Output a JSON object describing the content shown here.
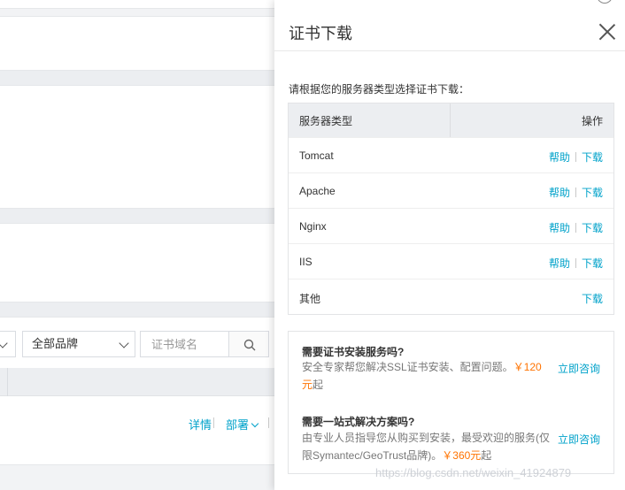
{
  "background": {
    "filter": {
      "brand_select": "全部品牌",
      "domain_placeholder": "证书域名"
    },
    "row_actions": {
      "detail": "详情",
      "deploy": "部署"
    }
  },
  "drawer": {
    "title": "证书下载",
    "instruction": "请根据您的服务器类型选择证书下载：",
    "table": {
      "headers": {
        "type": "服务器类型",
        "op": "操作"
      },
      "rows": [
        {
          "name": "Tomcat",
          "help": "帮助",
          "download": "下载"
        },
        {
          "name": "Apache",
          "help": "帮助",
          "download": "下载"
        },
        {
          "name": "Nginx",
          "help": "帮助",
          "download": "下载"
        },
        {
          "name": "IIS",
          "help": "帮助",
          "download": "下载"
        },
        {
          "name": "其他",
          "download": "下载"
        }
      ]
    },
    "services": [
      {
        "title": "需要证书安装服务吗?",
        "desc_prefix": "安全专家帮您解决SSL证书安装、配置问题。",
        "price": "￥120元",
        "desc_suffix": "起",
        "consult": "立即咨询"
      },
      {
        "title": "需要一站式解决方案吗?",
        "desc_prefix": "由专业人员指导您从购买到安装，最受欢迎的服务(仅限Symantec/GeoTrust品牌)。",
        "price": "￥360元",
        "desc_suffix": "起",
        "consult": "立即咨询"
      }
    ]
  },
  "watermark": "https://blog.csdn.net/weixin_41924879",
  "colors": {
    "link": "#00a2ca",
    "price": "#ff7300",
    "header_bg": "#eceef1"
  }
}
